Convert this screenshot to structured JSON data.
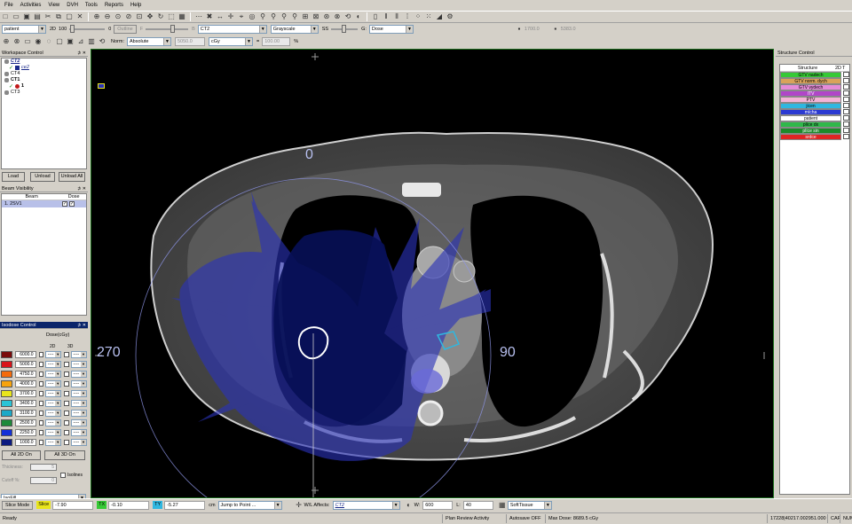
{
  "menu": [
    "File",
    "Activities",
    "View",
    "DVH",
    "Tools",
    "Reports",
    "Help"
  ],
  "toolbar2": {
    "patient_combo": "patient",
    "mode_label": "2D",
    "opacity_value": "100",
    "opacity_zero": "0",
    "outline_label": "Outline",
    "fill_label": "F",
    "b_label": "B",
    "image_combo": "CT2",
    "colormap_combo": "Grayscale",
    "ss_label": "SS",
    "g_label": "G:",
    "g_combo": "Dose",
    "range_low": "1700.0",
    "range_high": "5383.0"
  },
  "toolbar3": {
    "norm_label": "Norm:",
    "norm_combo": "Absolute",
    "norm_value": "5050.0",
    "unit_combo": "cGy",
    "equals_label": "=",
    "percent_value": "100.00",
    "percent_sign": "%"
  },
  "workspace": {
    "title": "Workspace Control",
    "items": [
      {
        "label": "CT2",
        "style": "ital"
      },
      {
        "label": "ce2",
        "style": "ital"
      },
      {
        "label": "CT4",
        "style": "normal"
      },
      {
        "label": "CT1",
        "style": "bold"
      },
      {
        "label": "1",
        "style": "bold"
      },
      {
        "label": "CT3",
        "style": "normal"
      }
    ],
    "load_button": "Load",
    "unload_button": "Unload",
    "unload_all_button": "Unload All"
  },
  "beam": {
    "title": "Beam Visibility",
    "col_beam": "Beam",
    "col_dose": "Dose",
    "rows": [
      {
        "name": "1. 2SV1"
      }
    ]
  },
  "isodose": {
    "title": "Isodose Control",
    "dose_header": "Dose(cGy)",
    "col_2d": "2D",
    "col_3d": "3D",
    "levels": [
      {
        "value": "6000.0",
        "color": "#7a0a0a"
      },
      {
        "value": "5000.0",
        "color": "#d8131a"
      },
      {
        "value": "4750.0",
        "color": "#f46b0c"
      },
      {
        "value": "4000.0",
        "color": "#f7a30e"
      },
      {
        "value": "3700.0",
        "color": "#e9e51d"
      },
      {
        "value": "3400.0",
        "color": "#2bc4d6"
      },
      {
        "value": "3100.0",
        "color": "#1ca9c7"
      },
      {
        "value": "2500.0",
        "color": "#1d8a3a"
      },
      {
        "value": "2250.0",
        "color": "#1230d8"
      },
      {
        "value": "1000.0",
        "color": "#0c1a80"
      }
    ],
    "line_style": "----",
    "all_2d_button": "All 2D On",
    "all_3d_button": "All 3D On",
    "thickness_label": "Thickness:",
    "thickness_value": "5",
    "cutoff_label": "Cutoff %:",
    "cutoff_value": "0",
    "isolines_label": "Isolines",
    "fill_combo": "IsoFill"
  },
  "viewer": {
    "angle_top": "0",
    "angle_left": "270",
    "angle_right": "90"
  },
  "structure": {
    "title": "Structure Control",
    "col_structure": "Structure",
    "col_2d": "2D",
    "col_t": "T",
    "items": [
      {
        "name": "GTV nadech",
        "color": "#36c936"
      },
      {
        "name": "GTV norm. dych",
        "color": "#d9a35a"
      },
      {
        "name": "GTV vydech",
        "color": "#e58bd8"
      },
      {
        "name": "ITV",
        "color": "#b046c8"
      },
      {
        "name": "PTV",
        "color": "#f4b3d6"
      },
      {
        "name": "jicen",
        "color": "#2fb7e0"
      },
      {
        "name": "mícha",
        "color": "#2b3ad2"
      },
      {
        "name": "patient",
        "color": "#ffffff"
      },
      {
        "name": "plíce dx",
        "color": "#2fb84a"
      },
      {
        "name": "plíce sin",
        "color": "#1c8a2a"
      },
      {
        "name": "srdce",
        "color": "#e02424"
      }
    ]
  },
  "bottom": {
    "slice_mode": "Slice Mode",
    "z_label": "Slice",
    "z_value": "-7.90",
    "x_label": "TX",
    "x_value": "-0.10",
    "y_label": "TY",
    "y_value": "-5.27",
    "cm_label": "cm",
    "jump_combo": "Jump to Point ...",
    "wl_affects": "W/L Affects:",
    "wl_combo": "CT2",
    "window_label": "W:",
    "window_value": "600",
    "level_label": "L:",
    "level_value": "40",
    "preset_combo": "SoftTissue"
  },
  "status": {
    "ready": "Ready",
    "activity": "Plan Review Activity",
    "autosave": "Autosave OFF",
    "max_dose": "Max Dose: 8689.5 cGy",
    "code": "17228|40217.002951.000",
    "cap": "CAP",
    "num": "NUM"
  }
}
